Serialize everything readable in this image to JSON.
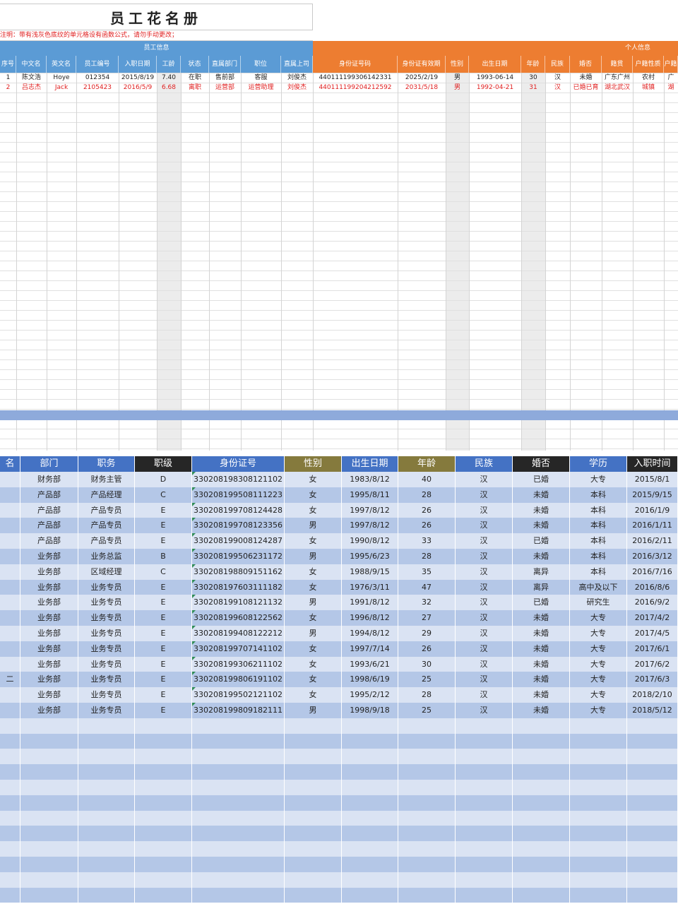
{
  "sheet1": {
    "title": "员工花名册",
    "note": "注明：带有浅灰色底纹的单元格设有函数公式，请勿手动更改；",
    "section_left": "员工信息",
    "section_right": "个人信息",
    "headers": [
      "序号",
      "中文名",
      "英文名",
      "员工编号",
      "入职日期",
      "工龄",
      "状态",
      "直属部门",
      "职位",
      "直属上司",
      "身份证号码",
      "身份证有效期",
      "性别",
      "出生日期",
      "年龄",
      "民族",
      "婚否",
      "籍贯",
      "户籍性质",
      "户籍"
    ],
    "rows": [
      {
        "style": "normal",
        "cells": [
          "1",
          "陈文浩",
          "Hoye",
          "012354",
          "2015/8/19",
          "7.40",
          "在职",
          "售前部",
          "客服",
          "刘俊杰",
          "440111199306142331",
          "2025/2/19",
          "男",
          "1993-06-14",
          "30",
          "汉",
          "未婚",
          "广东广州",
          "农村",
          "广"
        ]
      },
      {
        "style": "red",
        "cells": [
          "2",
          "吕志杰",
          "Jack",
          "2105423",
          "2016/5/9",
          "6.68",
          "离职",
          "运营部",
          "运营助理",
          "刘俊杰",
          "440111199204212592",
          "2031/5/18",
          "男",
          "1992-04-21",
          "31",
          "汉",
          "已婚已育",
          "湖北武汉",
          "城镇",
          "湖"
        ]
      }
    ]
  },
  "sheet2": {
    "headers": [
      "名",
      "部门",
      "职务",
      "职级",
      "身份证号",
      "性别",
      "出生日期",
      "年龄",
      "民族",
      "婚否",
      "学历",
      "入职时间"
    ],
    "rows": [
      [
        "",
        "财务部",
        "财务主管",
        "D",
        "330208198308121102",
        "女",
        "1983/8/12",
        "40",
        "汉",
        "已婚",
        "大专",
        "2015/8/1"
      ],
      [
        "",
        "产品部",
        "产品经理",
        "C",
        "330208199508111223",
        "女",
        "1995/8/11",
        "28",
        "汉",
        "未婚",
        "本科",
        "2015/9/15"
      ],
      [
        "",
        "产品部",
        "产品专员",
        "E",
        "330208199708124428",
        "女",
        "1997/8/12",
        "26",
        "汉",
        "未婚",
        "本科",
        "2016/1/9"
      ],
      [
        "",
        "产品部",
        "产品专员",
        "E",
        "330208199708123356",
        "男",
        "1997/8/12",
        "26",
        "汉",
        "未婚",
        "本科",
        "2016/1/11"
      ],
      [
        "",
        "产品部",
        "产品专员",
        "E",
        "330208199008124287",
        "女",
        "1990/8/12",
        "33",
        "汉",
        "已婚",
        "本科",
        "2016/2/11"
      ],
      [
        "",
        "业务部",
        "业务总监",
        "B",
        "330208199506231172",
        "男",
        "1995/6/23",
        "28",
        "汉",
        "未婚",
        "本科",
        "2016/3/12"
      ],
      [
        "",
        "业务部",
        "区域经理",
        "C",
        "330208198809151162",
        "女",
        "1988/9/15",
        "35",
        "汉",
        "离异",
        "本科",
        "2016/7/16"
      ],
      [
        "",
        "业务部",
        "业务专员",
        "E",
        "330208197603111182",
        "女",
        "1976/3/11",
        "47",
        "汉",
        "离异",
        "高中及以下",
        "2016/8/6"
      ],
      [
        "",
        "业务部",
        "业务专员",
        "E",
        "330208199108121132",
        "男",
        "1991/8/12",
        "32",
        "汉",
        "已婚",
        "研究生",
        "2016/9/2"
      ],
      [
        "",
        "业务部",
        "业务专员",
        "E",
        "330208199608122562",
        "女",
        "1996/8/12",
        "27",
        "汉",
        "未婚",
        "大专",
        "2017/4/2"
      ],
      [
        "",
        "业务部",
        "业务专员",
        "E",
        "330208199408122212",
        "男",
        "1994/8/12",
        "29",
        "汉",
        "未婚",
        "大专",
        "2017/4/5"
      ],
      [
        "",
        "业务部",
        "业务专员",
        "E",
        "330208199707141102",
        "女",
        "1997/7/14",
        "26",
        "汉",
        "未婚",
        "大专",
        "2017/6/1"
      ],
      [
        "",
        "业务部",
        "业务专员",
        "E",
        "330208199306211102",
        "女",
        "1993/6/21",
        "30",
        "汉",
        "未婚",
        "大专",
        "2017/6/2"
      ],
      [
        "二",
        "业务部",
        "业务专员",
        "E",
        "330208199806191102",
        "女",
        "1998/6/19",
        "25",
        "汉",
        "未婚",
        "大专",
        "2017/6/3"
      ],
      [
        "",
        "业务部",
        "业务专员",
        "E",
        "330208199502121102",
        "女",
        "1995/2/12",
        "28",
        "汉",
        "未婚",
        "大专",
        "2018/2/10"
      ],
      [
        "",
        "业务部",
        "业务专员",
        "E",
        "330208199809182111",
        "男",
        "1998/9/18",
        "25",
        "汉",
        "未婚",
        "大专",
        "2018/5/12"
      ]
    ],
    "empty_rows": 12
  },
  "colors": {
    "blue_header": "#5b9bd5",
    "orange_header": "#ed7d31",
    "note_red": "#e02020",
    "band_light": "#dae3f3",
    "band_dark": "#b4c7e7",
    "head_blue": "#4472c4",
    "head_dark": "#262626",
    "head_olive": "#857a3d"
  }
}
